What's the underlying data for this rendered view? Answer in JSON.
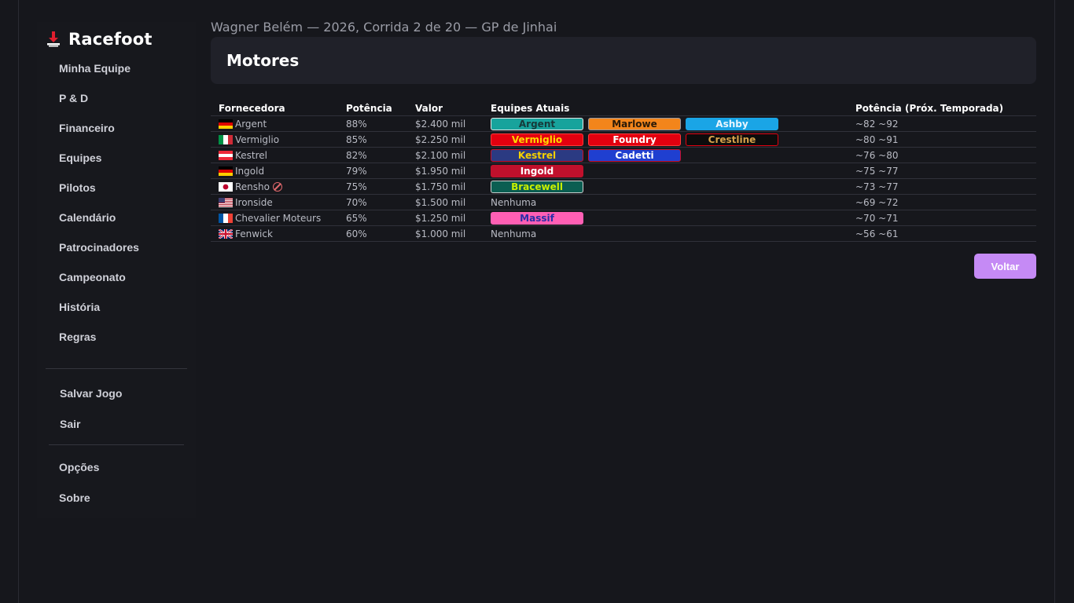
{
  "brand": {
    "title": "Racefoot",
    "icon": "racefoot-logo-icon"
  },
  "sidebar": {
    "items": [
      {
        "id": "minha-equipe",
        "label": "Minha Equipe"
      },
      {
        "id": "p-d",
        "label": "P & D"
      },
      {
        "id": "financeiro",
        "label": "Financeiro"
      },
      {
        "id": "equipes",
        "label": "Equipes"
      },
      {
        "id": "pilotos",
        "label": "Pilotos"
      },
      {
        "id": "calendario",
        "label": "Calendário"
      },
      {
        "id": "patrocinadores",
        "label": "Patrocinadores"
      },
      {
        "id": "campeonato",
        "label": "Campeonato"
      },
      {
        "id": "historia",
        "label": "História"
      },
      {
        "id": "regras",
        "label": "Regras"
      }
    ],
    "game_items": [
      {
        "id": "salvar-jogo",
        "label": "Salvar Jogo"
      },
      {
        "id": "sair",
        "label": "Sair"
      }
    ],
    "extra_items": [
      {
        "id": "opcoes",
        "label": "Opções"
      },
      {
        "id": "sobre",
        "label": "Sobre"
      }
    ]
  },
  "header": {
    "subtitle": "Wagner Belém — 2026, Corrida 2 de 20 — GP de Jinhai",
    "title": "Motores"
  },
  "table": {
    "columns": [
      "Fornecedora",
      "Potência",
      "Valor",
      "Equipes Atuais",
      "Potência (Próx. Temporada)"
    ],
    "none_label": "Nenhuma",
    "rows": [
      {
        "supplier": "Argent",
        "flag": "de",
        "power": "88%",
        "value": "$2.400 mil",
        "next": "~82 ~92",
        "teams": [
          {
            "name": "Argent",
            "bg": "#17a39c",
            "fg": "#173a3a",
            "border": "#e6e6e6"
          },
          {
            "name": "Marlowe",
            "bg": "#f3851b",
            "fg": "#2a1a08",
            "border": "#9a9aa2"
          },
          {
            "name": "Ashby",
            "bg": "#1aa5e6",
            "fg": "#e8f6ff",
            "border": "#1aa5e6"
          }
        ]
      },
      {
        "supplier": "Vermiglio",
        "flag": "it",
        "power": "85%",
        "value": "$2.250 mil",
        "next": "~80 ~91",
        "teams": [
          {
            "name": "Vermiglio",
            "bg": "#e3000f",
            "fg": "#ffd800",
            "border": "#ff3a3a"
          },
          {
            "name": "Foundry",
            "bg": "#e3000f",
            "fg": "#ffffff",
            "border": "#ff3a3a"
          },
          {
            "name": "Crestline",
            "bg": "#0c0c0c",
            "fg": "#d8a24a",
            "border": "#e3000f"
          }
        ]
      },
      {
        "supplier": "Kestrel",
        "flag": "at",
        "power": "82%",
        "value": "$2.100 mil",
        "next": "~76 ~80",
        "teams": [
          {
            "name": "Kestrel",
            "bg": "#2b3a82",
            "fg": "#f5d000",
            "border": "#c8102e"
          },
          {
            "name": "Cadetti",
            "bg": "#1f3fd0",
            "fg": "#ffffff",
            "border": "#c8102e"
          }
        ]
      },
      {
        "supplier": "Ingold",
        "flag": "de",
        "power": "79%",
        "value": "$1.950 mil",
        "next": "~75 ~77",
        "teams": [
          {
            "name": "Ingold",
            "bg": "#c0102c",
            "fg": "#ffffff",
            "border": "#c0102c"
          }
        ]
      },
      {
        "supplier": "Rensho",
        "flag": "jp",
        "power": "75%",
        "value": "$1.750 mil",
        "next": "~73 ~77",
        "restricted_icon": "no-entry-icon",
        "teams": [
          {
            "name": "Bracewell",
            "bg": "#0b5e52",
            "fg": "#c8f000",
            "border": "#d0d0d0"
          }
        ]
      },
      {
        "supplier": "Ironside",
        "flag": "us",
        "power": "70%",
        "value": "$1.500 mil",
        "next": "~69 ~72",
        "teams": []
      },
      {
        "supplier": "Chevalier Moteurs",
        "flag": "fr",
        "power": "65%",
        "value": "$1.250 mil",
        "next": "~70 ~71",
        "teams": [
          {
            "name": "Massif",
            "bg": "#ff5fb4",
            "fg": "#2a2fa8",
            "border": "#ff5fb4"
          }
        ]
      },
      {
        "supplier": "Fenwick",
        "flag": "gb",
        "power": "60%",
        "value": "$1.000 mil",
        "next": "~56 ~61",
        "teams": []
      }
    ]
  },
  "actions": {
    "back_label": "Voltar"
  }
}
